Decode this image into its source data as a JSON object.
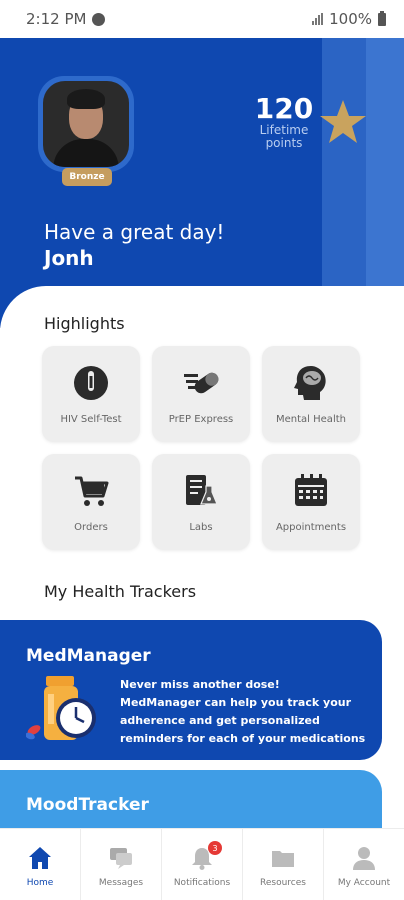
{
  "status_bar": {
    "time": "2:12 PM",
    "battery": "100%"
  },
  "profile": {
    "badge": "Bronze",
    "points_value": "120",
    "points_label_line1": "Lifetime",
    "points_label_line2": "points",
    "greeting": "Have a great day!",
    "name": "Jonh"
  },
  "highlights": {
    "title": "Highlights",
    "tiles": [
      {
        "label": "HIV Self-Test",
        "icon": "test-stick-icon"
      },
      {
        "label": "PrEP Express",
        "icon": "pill-icon"
      },
      {
        "label": "Mental Health",
        "icon": "brain-head-icon"
      },
      {
        "label": "Orders",
        "icon": "cart-icon"
      },
      {
        "label": "Labs",
        "icon": "lab-flask-icon"
      },
      {
        "label": "Appointments",
        "icon": "calendar-icon"
      }
    ]
  },
  "trackers": {
    "title": "My Health Trackers",
    "med_manager": {
      "title": "MedManager",
      "headline": "Never miss another dose!",
      "description": "MedManager can help you track your adherence and get personalized reminders for each of your medications"
    },
    "mood_tracker": {
      "title": "MoodTracker"
    }
  },
  "nav": {
    "items": [
      {
        "label": "Home",
        "icon": "home-icon"
      },
      {
        "label": "Messages",
        "icon": "chat-icon"
      },
      {
        "label": "Notifications",
        "icon": "bell-icon",
        "badge": "3"
      },
      {
        "label": "Resources",
        "icon": "folder-icon"
      },
      {
        "label": "My Account",
        "icon": "user-icon"
      }
    ]
  },
  "colors": {
    "primary": "#0f48b0",
    "accent_light": "#3f9de6",
    "gold": "#c59d5f",
    "tile_bg": "#eeeeee"
  }
}
